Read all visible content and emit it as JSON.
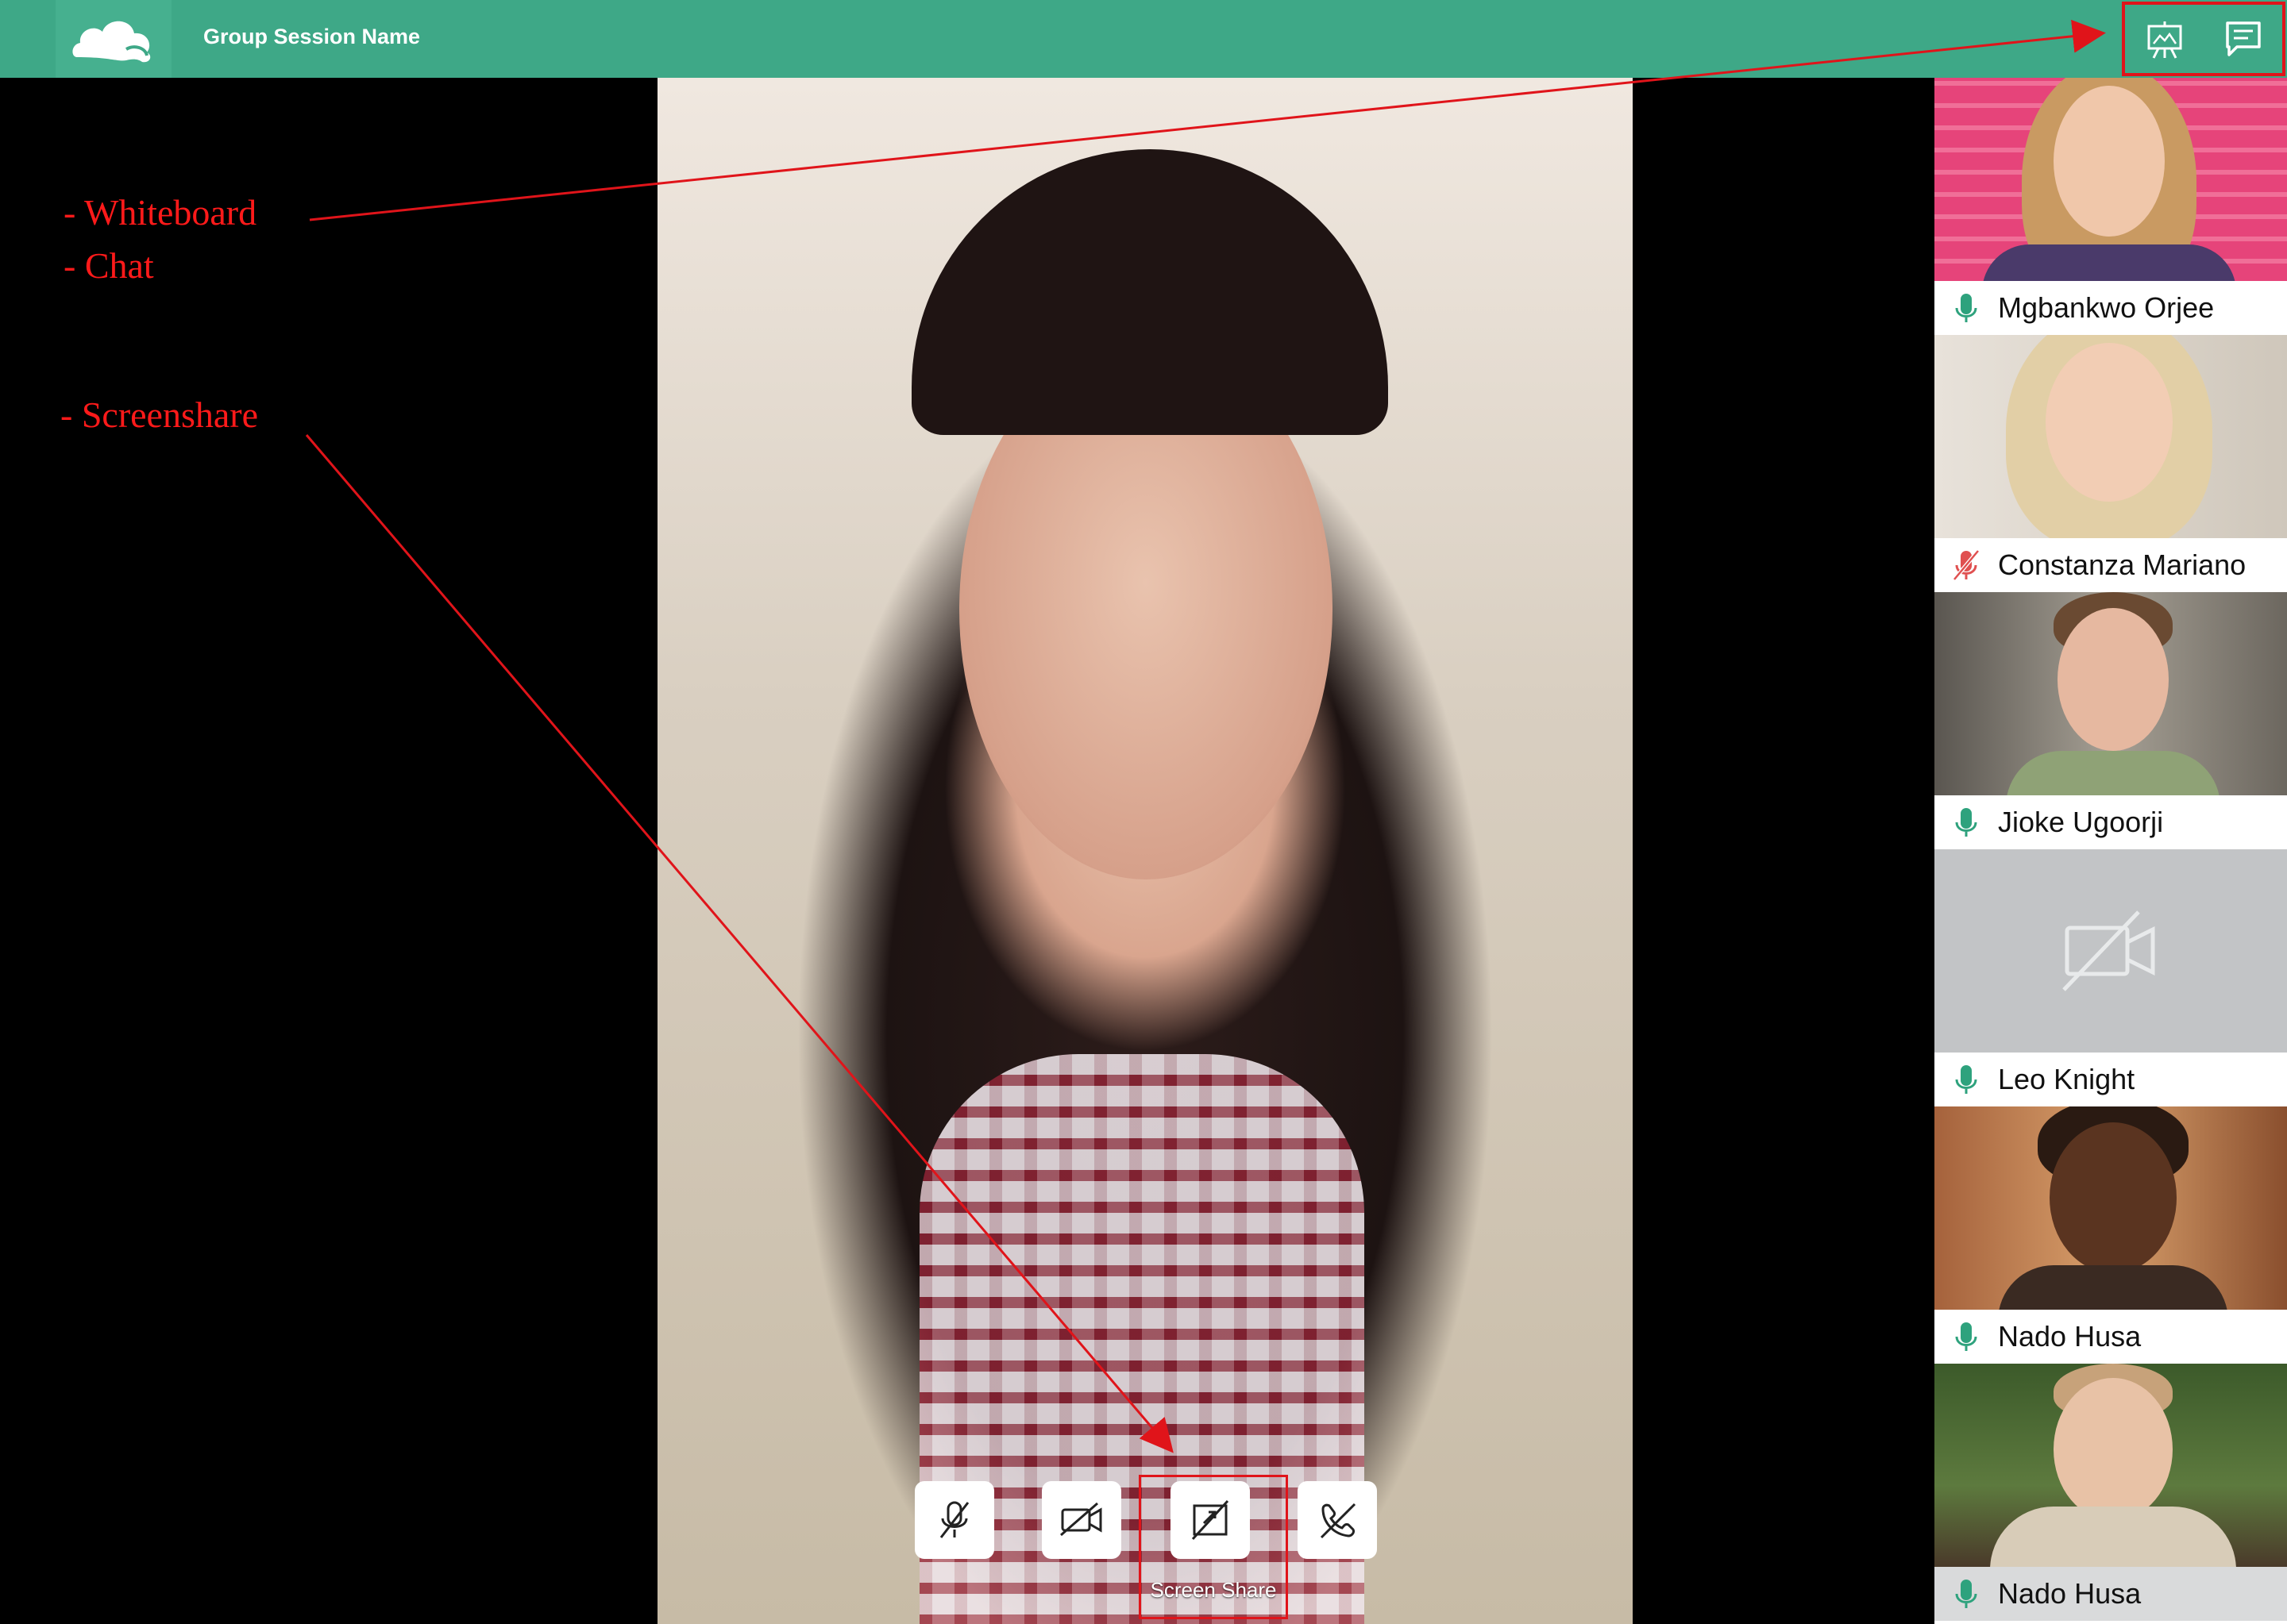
{
  "header": {
    "session_title": "Group Session Name",
    "logo_icon": "cloud-logo-icon",
    "actions": [
      {
        "name": "whiteboard",
        "icon": "whiteboard-icon"
      },
      {
        "name": "chat",
        "icon": "chat-icon"
      }
    ]
  },
  "annotations": {
    "whiteboard": "- Whiteboard",
    "chat": "- Chat",
    "screenshare": "- Screenshare",
    "color": "#ff1a1a"
  },
  "controls": {
    "mic_icon": "mic-off-icon",
    "camera_icon": "camera-off-icon",
    "screenshare_icon": "screen-share-off-icon",
    "leave_icon": "leave-call-icon",
    "screenshare_label": "Screen Share"
  },
  "participants": [
    {
      "name": "Mgbankwo Orjee",
      "mic": "on"
    },
    {
      "name": "Constanza Mariano",
      "mic": "off"
    },
    {
      "name": "Jioke Ugoorji",
      "mic": "on"
    },
    {
      "name": "Leo Knight",
      "mic": "on",
      "video": "off"
    },
    {
      "name": "Nado Husa",
      "mic": "on"
    },
    {
      "name": "Nado Husa",
      "mic": "on"
    }
  ],
  "colors": {
    "brand": "#3ea887",
    "mic_on": "#2ea27d",
    "mic_off": "#e05050",
    "annotation": "#ff1a1a"
  }
}
